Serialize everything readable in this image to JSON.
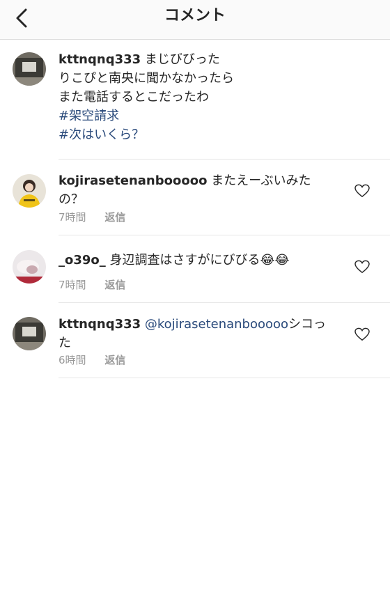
{
  "header": {
    "title": "コメント",
    "back_icon": "chevron-left-icon"
  },
  "caption": {
    "username": "kttnqnq333",
    "lines": [
      "まじびびった",
      "りこぴと南央に聞かなかったら",
      "また電話するとこだったわ"
    ],
    "hashtags": [
      "#架空請求",
      "#次はいくら？"
    ]
  },
  "comments": [
    {
      "username": "kojirasetenanbooooo",
      "text_line1": "またえーぶいみた",
      "text_line2": "の？",
      "time": "7時間",
      "reply_label": "返信"
    },
    {
      "username": "_o39o_",
      "text": "身辺調査はさすがにびびる😂😂",
      "time": "7時間",
      "reply_label": "返信"
    },
    {
      "username": "kttnqnq333",
      "mention": "@kojirasetenanbooooo",
      "text_after_mention": "シコっ",
      "text_line2": "た",
      "time": "6時間",
      "reply_label": "返信"
    }
  ],
  "colors": {
    "link": "#2a4a7b",
    "meta": "#999999",
    "text": "#262626"
  }
}
